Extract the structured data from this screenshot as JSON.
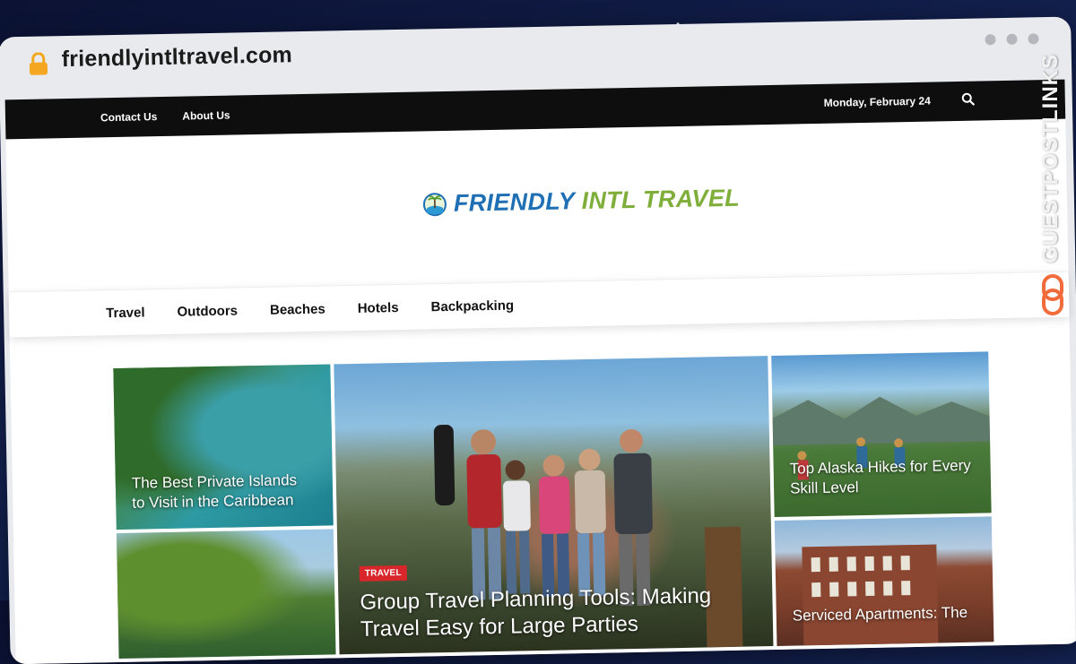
{
  "browser": {
    "url": "friendlyintltravel.com"
  },
  "topbar": {
    "links": [
      "Contact Us",
      "About Us"
    ],
    "date": "Monday, February 24"
  },
  "logo": {
    "part1": "FRIENDLY",
    "part2": "INTL TRAVEL"
  },
  "nav": {
    "items": [
      "Travel",
      "Outdoors",
      "Beaches",
      "Hotels",
      "Backpacking"
    ]
  },
  "posts": {
    "left_top": "The Best Private Islands to Visit in the Caribbean",
    "feature_badge": "TRAVEL",
    "feature_title": "Group Travel Planning Tools: Making Travel Easy for Large Parties",
    "right_top": "Top Alaska Hikes for Every Skill Level",
    "right_bottom": "Serviced Apartments: The"
  },
  "watermark": {
    "text": "GUESTPOSTLINKS"
  },
  "colors": {
    "topbar": "#0e0e0e",
    "logo_blue": "#1f6fb5",
    "logo_green": "#7fae3a",
    "badge_red": "#d9262b"
  },
  "icons": [
    "lock-icon",
    "search-icon",
    "globe-palm-icon",
    "link-icon"
  ]
}
